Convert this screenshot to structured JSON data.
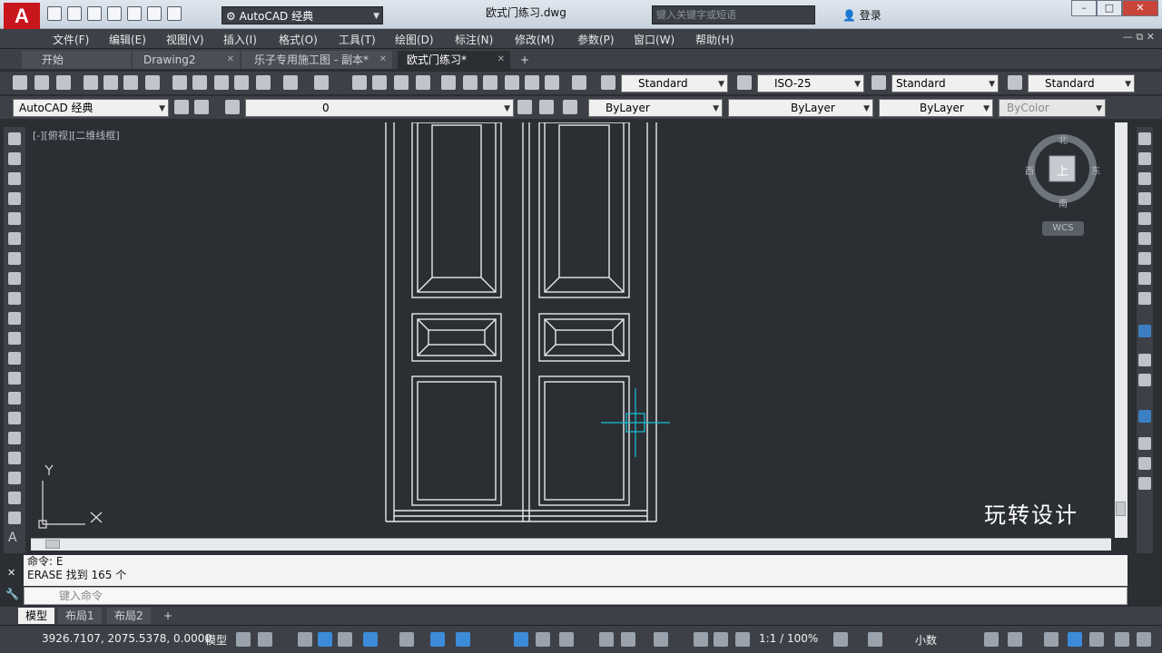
{
  "app": {
    "logo_letter": "A",
    "doc_title": "欧式门练习.dwg",
    "workspace": "AutoCAD 经典",
    "search_placeholder": "键入关键字或短语",
    "login_label": "登录",
    "help_label": "?"
  },
  "menu": [
    "文件(F)",
    "编辑(E)",
    "视图(V)",
    "插入(I)",
    "格式(O)",
    "工具(T)",
    "绘图(D)",
    "标注(N)",
    "修改(M)",
    "参数(P)",
    "窗口(W)",
    "帮助(H)"
  ],
  "tabs": [
    {
      "label": "开始"
    },
    {
      "label": "Drawing2"
    },
    {
      "label": "乐子专用施工图 - 副本*"
    },
    {
      "label": "欧式门练习*"
    }
  ],
  "styles_toolbar": {
    "text_style": "Standard",
    "dim_style": "ISO-25",
    "table_style": "Standard",
    "mleader_style": "Standard"
  },
  "layers_toolbar": {
    "workspace": "AutoCAD 经典",
    "layer": "0",
    "color": "ByLayer",
    "linetype": "ByLayer",
    "lineweight": "ByLayer",
    "plotstyle": "ByColor"
  },
  "viewport_label": "[-][俯视][二维线框]",
  "navcube": {
    "north": "北",
    "south": "南",
    "east": "东",
    "west": "西",
    "face": "上",
    "wcs": "WCS"
  },
  "command": {
    "history": [
      "命令: E",
      "ERASE 找到 165 个"
    ],
    "placeholder": "键入命令"
  },
  "layout_tabs": [
    "模型",
    "布局1",
    "布局2"
  ],
  "status": {
    "coords": "3926.7107, 2075.5378, 0.0000",
    "model": "模型",
    "scale": "1:1 / 100%",
    "units": "小数"
  },
  "watermark": "玩转设计",
  "colors": {
    "accent": "#c8161d",
    "canvas": "#2b2e33",
    "cursor": "#19c3d8",
    "ui_dark": "#3d4047"
  }
}
